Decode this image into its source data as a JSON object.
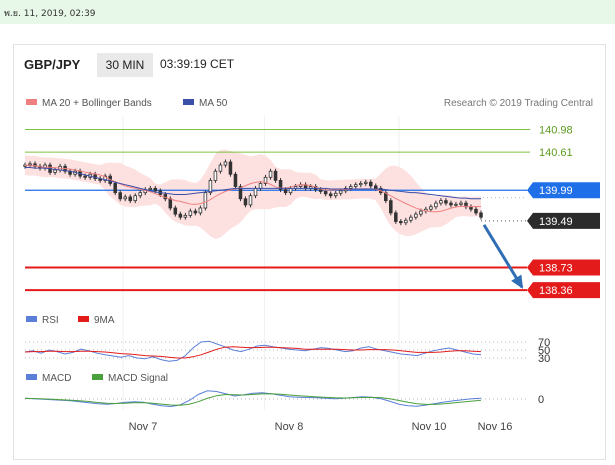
{
  "topbar": {
    "date": "พ.ย. 11, 2019, 02:39"
  },
  "header": {
    "pair": "GBP/JPY",
    "timeframe": "30 MIN",
    "time": "03:39:19 CET"
  },
  "legend": {
    "ma20": "MA 20 + Bollinger Bands",
    "ma50": "MA 50",
    "copyright": "Research © 2019 Trading Central"
  },
  "colors": {
    "ma20": "#f08080",
    "ma50": "#3a4fa8",
    "resistance": "#7dc240",
    "pivot": "#1e6fe8",
    "support": "#e31b1b",
    "arrow": "#2f6db4",
    "band": "#fde0e0"
  },
  "chart_data": [
    {
      "type": "line",
      "title": "",
      "x_labels": [
        "Nov 7",
        "Nov 8",
        "Nov 10",
        "Nov 16"
      ],
      "ylim": [
        138.2,
        141.2
      ],
      "levels": [
        {
          "value": 140.98,
          "label": "140.98",
          "kind": "resistance"
        },
        {
          "value": 140.61,
          "label": "140.61",
          "kind": "resistance"
        },
        {
          "value": 139.99,
          "label": "139.99",
          "kind": "pivot"
        },
        {
          "value": 139.49,
          "label": "139.49",
          "kind": "last-price"
        },
        {
          "value": 138.73,
          "label": "138.73",
          "kind": "support"
        },
        {
          "value": 138.36,
          "label": "138.36",
          "kind": "support"
        }
      ],
      "close": [
        140.4,
        140.42,
        140.38,
        140.35,
        140.4,
        140.28,
        140.32,
        140.38,
        140.3,
        140.25,
        140.3,
        140.22,
        140.2,
        140.25,
        140.18,
        140.15,
        140.22,
        140.1,
        139.95,
        139.85,
        139.88,
        139.82,
        139.9,
        139.95,
        140.0,
        140.02,
        139.98,
        139.92,
        139.85,
        139.7,
        139.6,
        139.55,
        139.58,
        139.65,
        139.62,
        139.7,
        139.95,
        140.15,
        140.3,
        140.4,
        140.45,
        140.25,
        140.05,
        139.85,
        139.75,
        139.9,
        140.02,
        140.1,
        140.2,
        140.3,
        140.15,
        140.0,
        139.95,
        140.02,
        140.05,
        140.08,
        140.02,
        140.05,
        140.0,
        139.97,
        139.93,
        139.9,
        139.94,
        139.98,
        140.02,
        140.05,
        140.08,
        140.1,
        140.12,
        140.06,
        140.02,
        139.95,
        139.82,
        139.62,
        139.48,
        139.46,
        139.5,
        139.55,
        139.6,
        139.65,
        139.68,
        139.72,
        139.78,
        139.82,
        139.78,
        139.75,
        139.76,
        139.78,
        139.72,
        139.68,
        139.62,
        139.55
      ],
      "ma50": [
        140.36,
        140.36,
        140.35,
        140.35,
        140.35,
        140.34,
        140.33,
        140.32,
        140.31,
        140.3,
        140.28,
        140.26,
        140.24,
        140.22,
        140.2,
        140.18,
        140.16,
        140.14,
        140.12,
        140.1,
        140.08,
        140.06,
        140.04,
        140.02,
        140.0,
        139.98,
        139.96,
        139.95,
        139.94,
        139.93,
        139.92,
        139.92,
        139.92,
        139.93,
        139.94,
        139.95,
        139.96,
        139.97,
        139.98,
        139.99,
        140.0,
        140.01,
        140.02,
        140.02,
        140.02,
        140.02,
        140.02,
        140.02,
        140.02,
        140.02,
        140.02,
        140.02,
        140.02,
        140.02,
        140.02,
        140.02,
        140.02,
        140.02,
        140.02,
        140.02,
        140.02,
        140.01,
        140.01,
        140.01,
        140.01,
        140.01,
        140.01,
        140.01,
        140.01,
        140.01,
        140.01,
        140.01,
        140.0,
        139.99,
        139.98,
        139.97,
        139.96,
        139.95,
        139.95,
        139.94,
        139.93,
        139.92,
        139.91,
        139.9,
        139.89,
        139.88,
        139.87,
        139.86,
        139.86,
        139.85,
        139.85,
        139.85
      ],
      "projection": {
        "from": 139.49,
        "to": 138.36
      }
    },
    {
      "type": "line",
      "title": "",
      "ylim": [
        20,
        90
      ],
      "levels": [
        {
          "value": 70,
          "label": "70"
        },
        {
          "value": 50,
          "label": "50"
        },
        {
          "value": 30,
          "label": "30"
        }
      ],
      "series": [
        {
          "name": "RSI",
          "color": "#5b7ed8",
          "values": [
            45,
            48,
            42,
            50,
            46,
            40,
            44,
            52,
            48,
            42,
            38,
            35,
            32,
            36,
            30,
            28,
            33,
            26,
            22,
            24,
            35,
            55,
            70,
            72,
            65,
            58,
            50,
            46,
            52,
            60,
            62,
            58,
            55,
            52,
            50,
            48,
            52,
            56,
            54,
            50,
            46,
            48,
            55,
            58,
            52,
            48,
            44,
            40,
            38,
            36,
            42,
            48,
            52,
            55,
            50,
            45,
            40,
            38
          ]
        },
        {
          "name": "9MA",
          "color": "#e31b1b",
          "values": [
            45,
            46,
            46,
            47,
            47,
            46,
            46,
            47,
            47,
            46,
            45,
            43,
            41,
            40,
            38,
            36,
            35,
            34,
            32,
            30,
            30,
            33,
            38,
            45,
            52,
            57,
            58,
            57,
            56,
            56,
            57,
            57,
            56,
            55,
            54,
            52,
            52,
            52,
            52,
            52,
            51,
            50,
            50,
            51,
            51,
            51,
            50,
            48,
            46,
            44,
            44,
            44,
            45,
            47,
            48,
            48,
            47,
            46
          ]
        }
      ]
    },
    {
      "type": "line",
      "title": "",
      "ylim": [
        -1,
        1
      ],
      "levels": [
        {
          "value": 0,
          "label": "0"
        }
      ],
      "series": [
        {
          "name": "MACD",
          "color": "#5b7ed8",
          "values": [
            0.05,
            0.02,
            -0.02,
            -0.05,
            -0.08,
            -0.12,
            -0.18,
            -0.25,
            -0.32,
            -0.35,
            -0.3,
            -0.22,
            -0.18,
            -0.22,
            -0.35,
            -0.45,
            -0.5,
            -0.4,
            -0.1,
            0.3,
            0.55,
            0.5,
            0.35,
            0.2,
            0.28,
            0.38,
            0.42,
            0.35,
            0.25,
            0.15,
            0.12,
            0.1,
            0.08,
            0.05,
            0.02,
            0.05,
            0.1,
            0.15,
            0.12,
            0.02,
            -0.15,
            -0.35,
            -0.45,
            -0.48,
            -0.4,
            -0.3,
            -0.2,
            -0.12,
            -0.05,
            0.02,
            0.05
          ]
        },
        {
          "name": "MACD Signal",
          "color": "#4aa03c",
          "values": [
            0.04,
            0.03,
            0.01,
            -0.02,
            -0.05,
            -0.08,
            -0.12,
            -0.17,
            -0.23,
            -0.28,
            -0.3,
            -0.28,
            -0.25,
            -0.24,
            -0.28,
            -0.34,
            -0.4,
            -0.42,
            -0.35,
            -0.18,
            0.05,
            0.22,
            0.3,
            0.28,
            0.27,
            0.3,
            0.34,
            0.35,
            0.32,
            0.27,
            0.22,
            0.18,
            0.14,
            0.11,
            0.08,
            0.07,
            0.08,
            0.1,
            0.11,
            0.09,
            0.02,
            -0.1,
            -0.22,
            -0.32,
            -0.36,
            -0.36,
            -0.32,
            -0.26,
            -0.2,
            -0.14,
            -0.08
          ]
        }
      ]
    }
  ]
}
